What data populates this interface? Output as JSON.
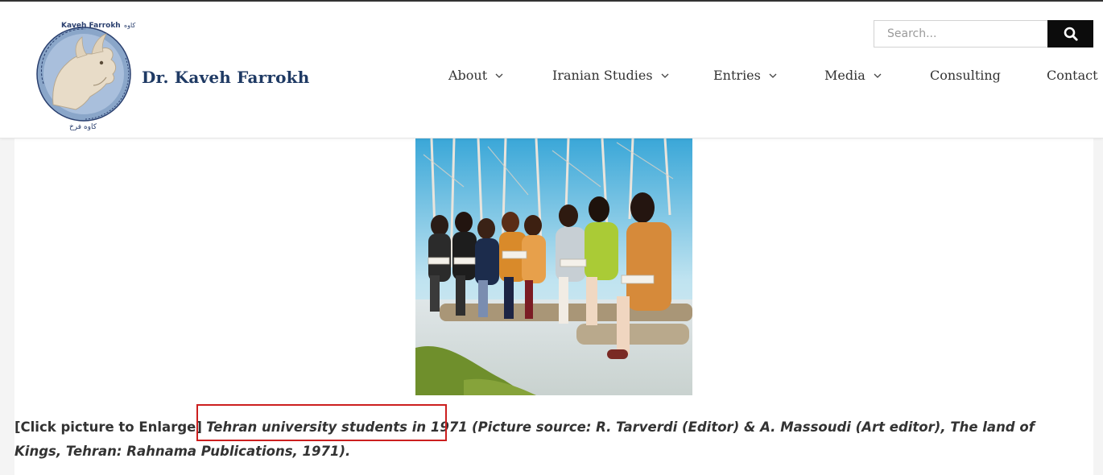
{
  "site": {
    "name": "Dr. Kaveh Farrokh",
    "emblem_lettering": [
      "Kaveh Farrokh",
      "کاوه فرخ"
    ]
  },
  "search": {
    "placeholder": "Search...",
    "value": ""
  },
  "nav": {
    "items": [
      {
        "label": "About",
        "has_dropdown": true
      },
      {
        "label": "Iranian Studies",
        "has_dropdown": true
      },
      {
        "label": "Entries",
        "has_dropdown": true
      },
      {
        "label": "Media",
        "has_dropdown": true
      },
      {
        "label": "Consulting",
        "has_dropdown": false
      },
      {
        "label": "Contact",
        "has_dropdown": false
      }
    ]
  },
  "article": {
    "photo_alt": "Tehran university students in 1971",
    "caption": {
      "prefix": "[Click picture to Enlarge]",
      "highlighted": "Tehran university students in 1971",
      "rest": "(Picture source: R. Tarverdi (Editor) & A. Massoudi (Art editor), The land of Kings, Tehran: Rahnama Publications, 1971)."
    }
  },
  "colors": {
    "brand_navy": "#1f3a64",
    "search_button": "#0c0c0c",
    "highlight_red": "#cc1f1f",
    "emblem_blue": "#8aa6c9"
  },
  "icons": {
    "search": "search-icon",
    "dropdown": "chevron-down-icon"
  }
}
